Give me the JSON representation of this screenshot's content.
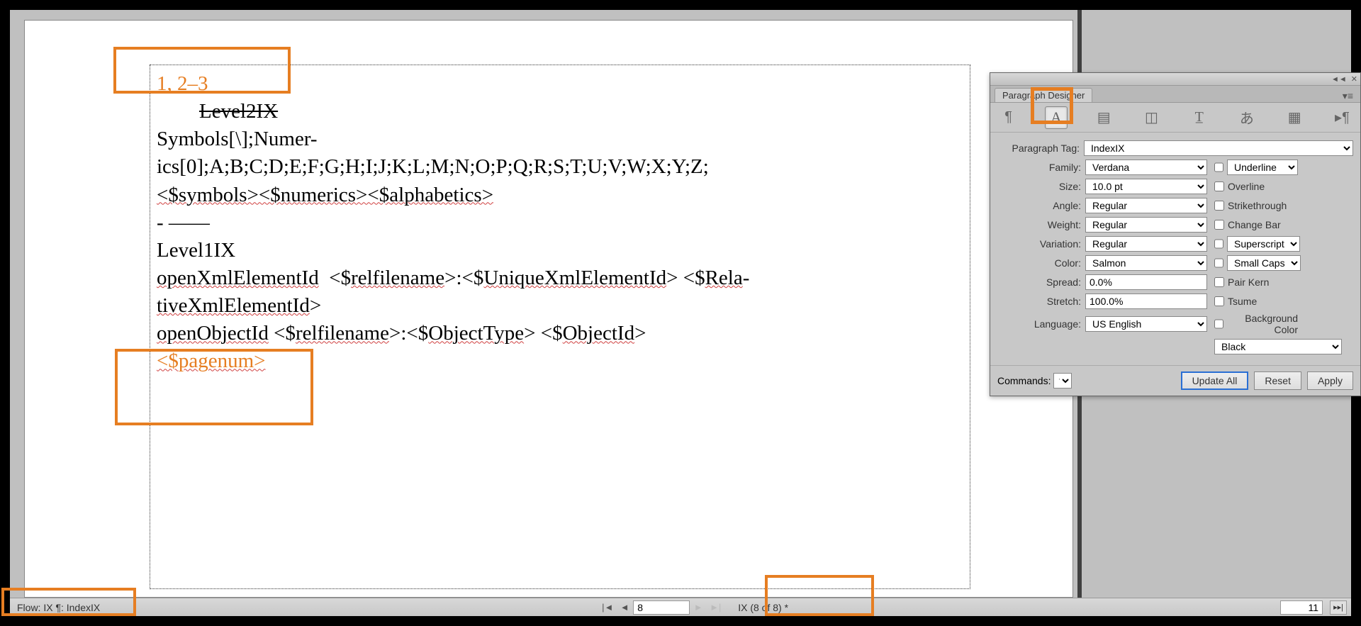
{
  "document": {
    "highlighted_text_1": "1, 2–3",
    "level2_text": "Level2IX",
    "line3a": "Symbols[\\];Numer-",
    "line3b": "ics[0];A;B;C;D;E;F;G;H;I;J;K;L;M;N;O;P;Q;R;S;T;U;V;W;X;Y;Z;",
    "line4": "<$symbols><$numerics><$alphabetics>",
    "line5": "- ——",
    "line6": "Level1IX",
    "line7": "openXmlElementId  <$relfilename>:<$UniqueXmlElementId> <$Rela-",
    "line7b": "tiveXmlElementId>",
    "line8": "openObjectId <$relfilename>:<$ObjectType> <$ObjectId>",
    "highlighted_text_2": "<$pagenum>"
  },
  "statusbar": {
    "flow_label": "Flow: IX  ¶: IndexIX",
    "page_input": "8",
    "page_position": "IX (8 of 8) *",
    "zoom": "11"
  },
  "panel": {
    "title": "Paragraph Designer",
    "paragraph_tag_label": "Paragraph Tag:",
    "paragraph_tag_value": "IndexIX",
    "family_label": "Family:",
    "family_value": "Verdana",
    "size_label": "Size:",
    "size_value": "10.0 pt",
    "angle_label": "Angle:",
    "angle_value": "Regular",
    "weight_label": "Weight:",
    "weight_value": "Regular",
    "variation_label": "Variation:",
    "variation_value": "Regular",
    "color_label": "Color:",
    "color_value": "Salmon",
    "spread_label": "Spread:",
    "spread_value": "0.0%",
    "stretch_label": "Stretch:",
    "stretch_value": "100.0%",
    "language_label": "Language:",
    "language_value": "US English",
    "underline_label": "Underline",
    "overline_label": "Overline",
    "strikethrough_label": "Strikethrough",
    "changebar_label": "Change Bar",
    "superscript_label": "Superscript",
    "smallcaps_label": "Small Caps",
    "pairkern_label": "Pair Kern",
    "tsume_label": "Tsume",
    "bgcolor_label": "Background Color",
    "bgcolor_value": "Black",
    "commands_label": "Commands:",
    "update_all_label": "Update All",
    "reset_label": "Reset",
    "apply_label": "Apply"
  }
}
